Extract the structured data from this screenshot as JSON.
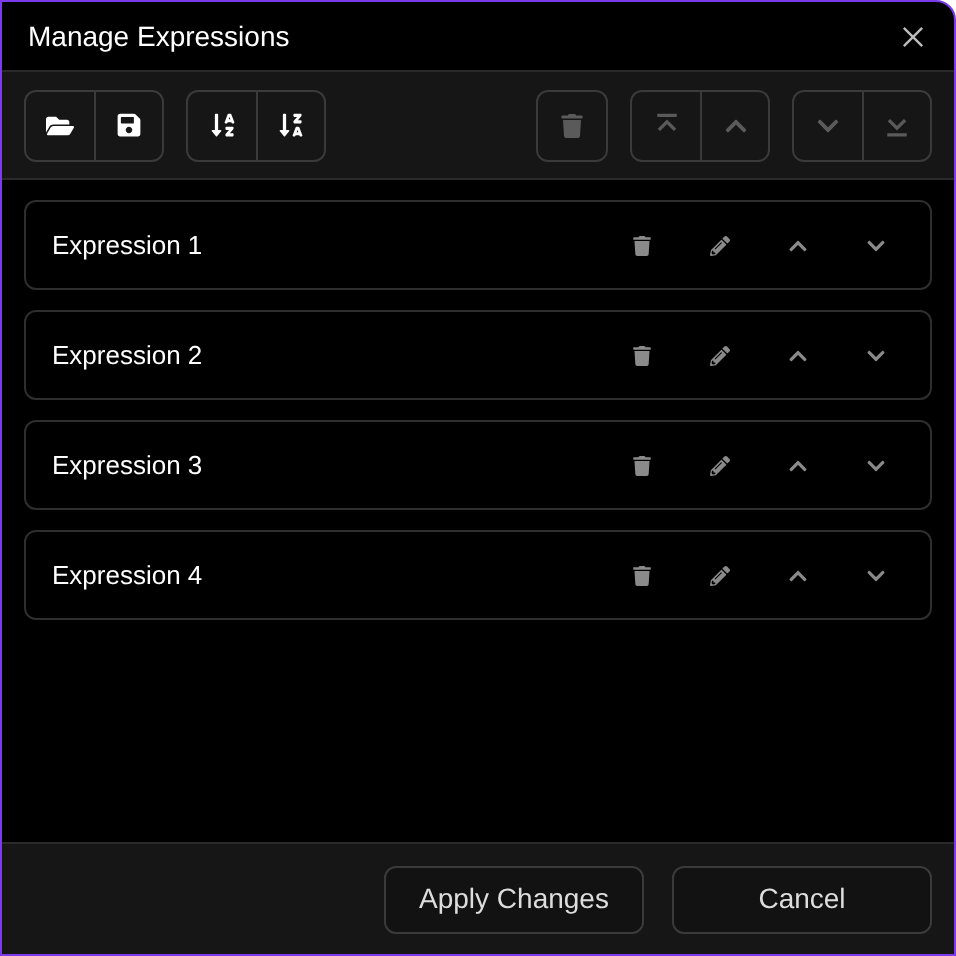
{
  "window": {
    "title": "Manage Expressions"
  },
  "toolbar": [
    {
      "kind": "file",
      "buttons": [
        {
          "kind": "open",
          "disabled": false
        },
        {
          "kind": "save",
          "disabled": false
        }
      ]
    },
    {
      "kind": "sort",
      "buttons": [
        {
          "kind": "sort-asc",
          "disabled": false
        },
        {
          "kind": "sort-desc",
          "disabled": false
        }
      ]
    },
    {
      "kind": "spacer"
    },
    {
      "kind": "delete",
      "buttons": [
        {
          "kind": "delete",
          "disabled": true
        }
      ]
    },
    {
      "kind": "move",
      "buttons": [
        {
          "kind": "top",
          "disabled": true
        },
        {
          "kind": "up",
          "disabled": true
        }
      ]
    },
    {
      "kind": "move",
      "buttons": [
        {
          "kind": "down",
          "disabled": true
        },
        {
          "kind": "bottom",
          "disabled": true
        }
      ]
    }
  ],
  "expressions": [
    {
      "name": "Expression 1"
    },
    {
      "name": "Expression 2"
    },
    {
      "name": "Expression 3"
    },
    {
      "name": "Expression 4"
    }
  ],
  "buttons": [
    {
      "label": "Apply Changes"
    },
    {
      "label": "Cancel"
    }
  ]
}
